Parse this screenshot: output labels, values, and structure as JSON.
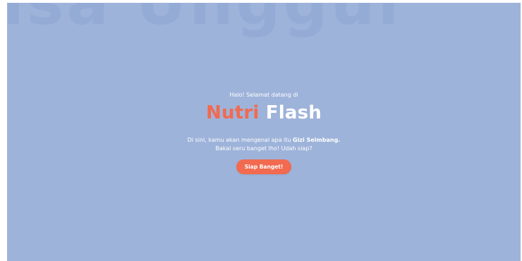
{
  "background_text": "isa Unggul",
  "hero": {
    "greeting": "Halo! Selamat datang di",
    "brand_part1": "Nutri",
    "brand_part2": "Flash",
    "desc_line1_prefix": "Di sini, kamu akan mengenal apa itu",
    "desc_line1_bold": "Gizi Seimbang.",
    "desc_line2": "Bakal seru banget lho! Udah siap?",
    "cta_label": "Siap Banget!"
  },
  "colors": {
    "panel_background": "#9eb3da",
    "accent": "#f26a4f",
    "text_light": "#ffffff"
  }
}
